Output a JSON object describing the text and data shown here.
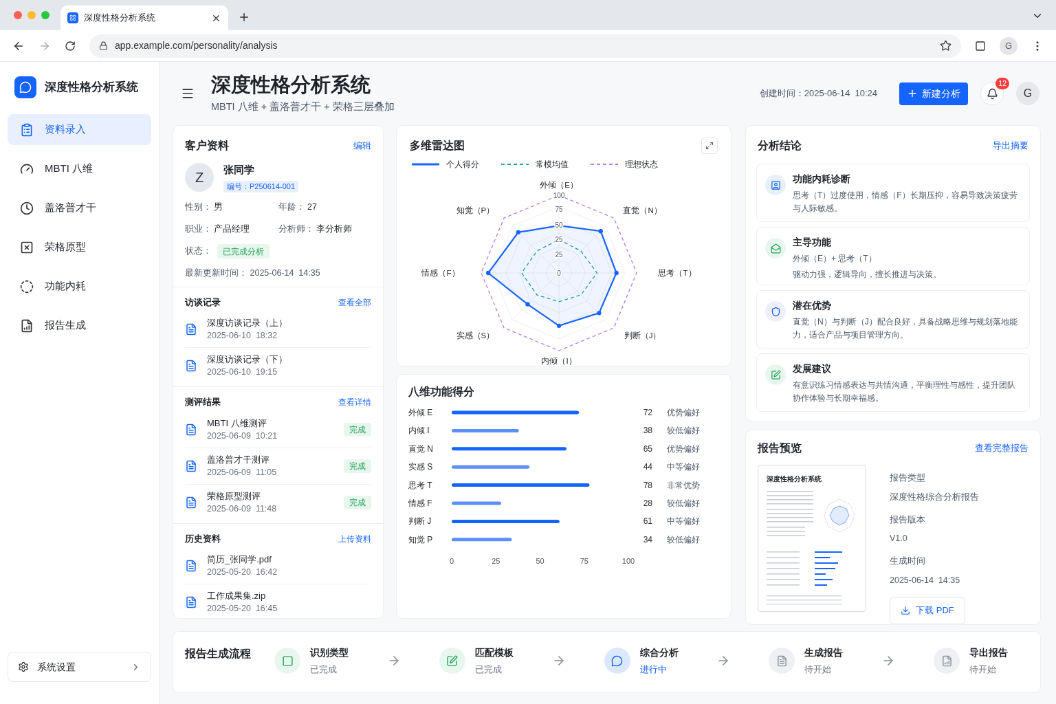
{
  "browser": {
    "tab_title": "深度性格分析系统",
    "url": "app.example.com/personality/analysis",
    "profile": "G"
  },
  "sidebar": {
    "brand": "深度性格分析系统",
    "items": [
      {
        "label": "资料录入",
        "selected": true
      },
      {
        "label": "MBTI 八维",
        "selected": false
      },
      {
        "label": "盖洛普才干",
        "selected": false
      },
      {
        "label": "荣格原型",
        "selected": false
      },
      {
        "label": "功能内耗",
        "selected": false
      },
      {
        "label": "报告生成",
        "selected": false
      }
    ],
    "settings": "系统设置"
  },
  "header": {
    "title": "深度性格分析系统",
    "subtitle": "MBTI 八维 + 盖洛普才干 + 荣格三层叠加",
    "created_label": "创建时间：",
    "created": "2025-06-14  10:24",
    "new_button": "新建分析",
    "notifications": "12",
    "avatar": "G"
  },
  "client": {
    "title": "客户资料",
    "action": "编辑",
    "avatar": "Z",
    "name": "张同学",
    "id": "编号：P250614-001",
    "fields": [
      {
        "label": "性别：",
        "value": "男"
      },
      {
        "label": "年龄：",
        "value": "27"
      },
      {
        "label": "职业：",
        "value": "产品经理"
      },
      {
        "label": "分析师：",
        "value": "李分析师"
      }
    ],
    "status_label": "状态：",
    "status": "已完成分析",
    "updated_label": "最新更新时间：",
    "updated": "2025-06-14  14:35",
    "sections": [
      {
        "title": "访谈记录",
        "action": "查看全部",
        "items": [
          {
            "name": "深度访谈记录（上）",
            "time": "2025-06-10  18:32"
          },
          {
            "name": "深度访谈记录（下）",
            "time": "2025-06-10  19:15"
          }
        ]
      },
      {
        "title": "测评结果",
        "action": "查看详情",
        "items": [
          {
            "name": "MBTI 八维测评",
            "time": "2025-06-09  10:21",
            "badge": "完成"
          },
          {
            "name": "盖洛普才干测评",
            "time": "2025-06-09  11:05",
            "badge": "完成"
          },
          {
            "name": "荣格原型测评",
            "time": "2025-06-09  11:48",
            "badge": "完成"
          }
        ]
      },
      {
        "title": "历史资料",
        "action": "上传资料",
        "items": [
          {
            "name": "简历_张同学.pdf",
            "time": "2025-05-20  16:42"
          },
          {
            "name": "工作成果集.zip",
            "time": "2025-05-20  16:45"
          }
        ]
      }
    ]
  },
  "radar": {
    "title": "多维雷达图",
    "axes": [
      "外倾（E）",
      "直觉（N）",
      "思考（T）",
      "判断（J）",
      "内倾（I）",
      "实感（S）",
      "情感（F）",
      "知觉（P）"
    ],
    "tick_labels": [
      "100",
      "75",
      "50",
      "25",
      "25",
      "0"
    ],
    "legend": [
      {
        "name": "个人得分",
        "color": "#1664ff"
      },
      {
        "name": "常模均值",
        "color": "#14a3a3"
      },
      {
        "name": "理想状态",
        "color": "#b07cf0"
      }
    ]
  },
  "scores": {
    "title": "八维功能得分",
    "chart_data": {
      "type": "bar",
      "orientation": "horizontal",
      "categories": [
        "外倾 E",
        "内倾 I",
        "直觉 N",
        "实感 S",
        "思考 T",
        "情感 F",
        "判断 J",
        "知觉 P"
      ],
      "values": [
        72,
        38,
        65,
        44,
        78,
        28,
        61,
        34
      ],
      "xlim": [
        0,
        100
      ],
      "xticks": [
        0,
        25,
        50,
        75,
        100
      ],
      "data_labels": true,
      "annotations": [
        "优势偏好",
        "较低偏好",
        "优势偏好",
        "中等偏好",
        "非常优势",
        "较低偏好",
        "中等偏好",
        "较低偏好"
      ]
    }
  },
  "conclusions": {
    "title": "分析结论",
    "action": "导出摘要",
    "items": [
      {
        "kind": "diagnosis",
        "title": "功能内耗诊断",
        "lines": [
          "思考（T）过度使用，情感（F）长期压抑，容易导致决策疲劳与人际敏感。"
        ]
      },
      {
        "kind": "dominant",
        "title": "主导功能",
        "lines": [
          "外倾（E）+ 思考（T）",
          "驱动力强，逻辑导向，擅长推进与决策。"
        ]
      },
      {
        "kind": "strength",
        "title": "潜在优势",
        "lines": [
          "直觉（N）与判断（J）配合良好，具备战略思维与规划落地能力，适合产品与项目管理方向。"
        ]
      },
      {
        "kind": "advice",
        "title": "发展建议",
        "lines": [
          "有意识练习情感表达与共情沟通，平衡理性与感性，提升团队协作体验与长期幸福感。"
        ]
      }
    ]
  },
  "preview": {
    "title": "报告预览",
    "action": "查看完整报告",
    "thumbnail_title": "深度性格分析系统",
    "fields": [
      {
        "label": "报告类型",
        "value": "深度性格综合分析报告"
      },
      {
        "label": "报告版本",
        "value": "V1.0"
      },
      {
        "label": "生成时间",
        "value": "2025-06-14  14:35"
      }
    ],
    "download": "下载 PDF"
  },
  "flow": {
    "title": "报告生成流程",
    "steps": [
      {
        "label": "识别类型",
        "status": "已完成",
        "kind": "done"
      },
      {
        "label": "匹配模板",
        "status": "已完成",
        "kind": "done"
      },
      {
        "label": "综合分析",
        "status": "进行中",
        "kind": "active"
      },
      {
        "label": "生成报告",
        "status": "待开始",
        "kind": "pending"
      },
      {
        "label": "导出报告",
        "status": "待开始",
        "kind": "pending"
      }
    ]
  }
}
